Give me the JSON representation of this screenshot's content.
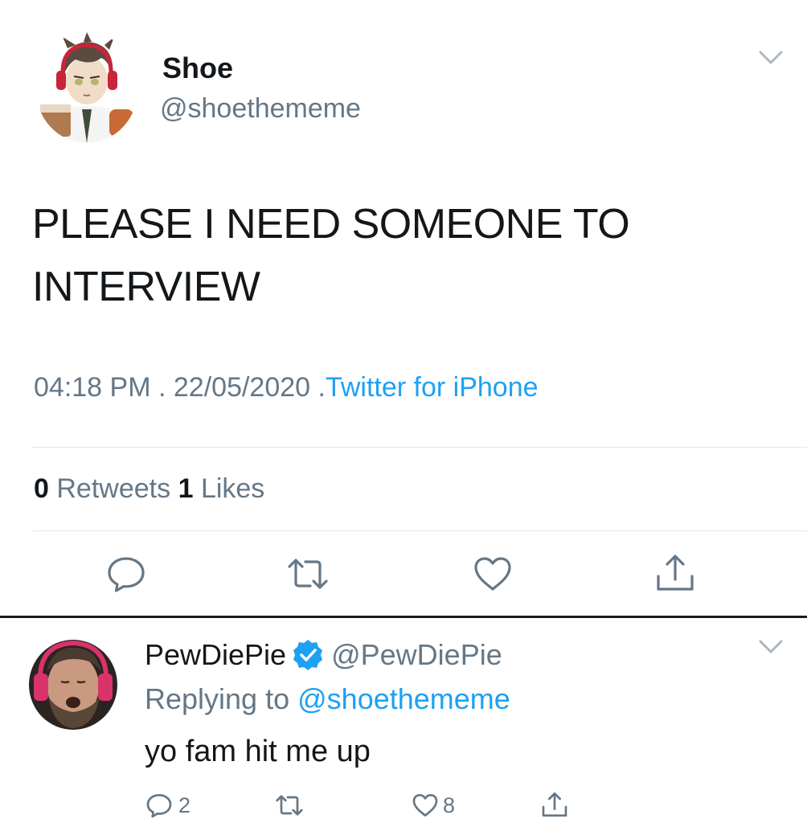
{
  "tweet": {
    "author": {
      "display_name": "Shoe",
      "handle": "@shoethememe",
      "avatar_icon": "anime-avatar-icon"
    },
    "text_line1": "PLEASE I NEED SOMEONE TO",
    "text_line2": "INTERVIEW",
    "time": "04:18 PM",
    "date": "22/05/2020",
    "separator": ".",
    "source": "Twitter for iPhone",
    "stats": {
      "retweets_count": "0",
      "retweets_label": "Retweets",
      "likes_count": "1",
      "likes_label": "Likes"
    },
    "actions": [
      "reply-icon",
      "retweet-icon",
      "like-icon",
      "share-icon"
    ]
  },
  "reply": {
    "author": {
      "display_name": "PewDiePie",
      "handle": "@PewDiePie",
      "verified": true,
      "avatar_icon": "user-photo-avatar"
    },
    "replying_prefix": "Replying to",
    "replying_handle": "@shoethememe",
    "text": "yo fam hit me up",
    "reply_count": "2",
    "retweet_count": "",
    "like_count": "8"
  },
  "colors": {
    "text": "#14171a",
    "secondary": "#657786",
    "accent": "#1da1f2",
    "divider": "#e1e8ed",
    "icon": "#657786"
  }
}
